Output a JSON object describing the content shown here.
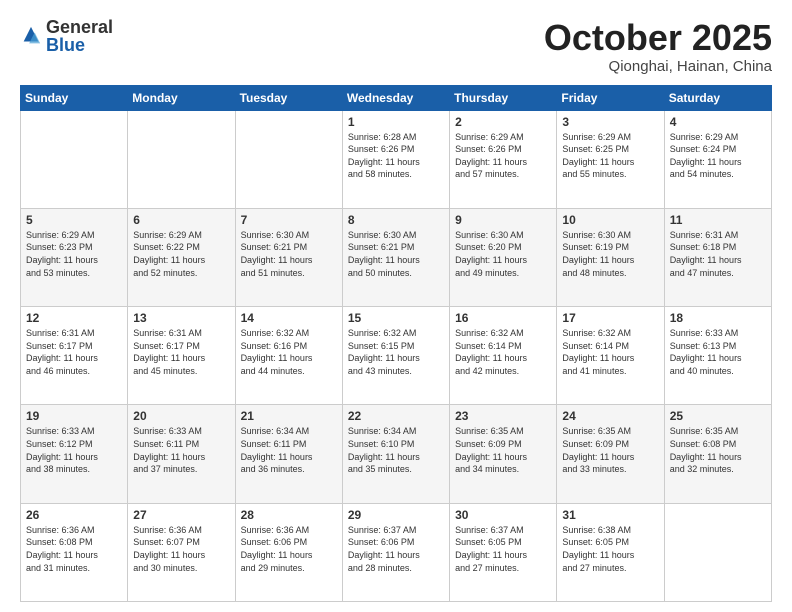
{
  "logo": {
    "general": "General",
    "blue": "Blue"
  },
  "title": "October 2025",
  "location": "Qionghai, Hainan, China",
  "weekdays": [
    "Sunday",
    "Monday",
    "Tuesday",
    "Wednesday",
    "Thursday",
    "Friday",
    "Saturday"
  ],
  "weeks": [
    [
      {
        "day": "",
        "info": ""
      },
      {
        "day": "",
        "info": ""
      },
      {
        "day": "",
        "info": ""
      },
      {
        "day": "1",
        "info": "Sunrise: 6:28 AM\nSunset: 6:26 PM\nDaylight: 11 hours\nand 58 minutes."
      },
      {
        "day": "2",
        "info": "Sunrise: 6:29 AM\nSunset: 6:26 PM\nDaylight: 11 hours\nand 57 minutes."
      },
      {
        "day": "3",
        "info": "Sunrise: 6:29 AM\nSunset: 6:25 PM\nDaylight: 11 hours\nand 55 minutes."
      },
      {
        "day": "4",
        "info": "Sunrise: 6:29 AM\nSunset: 6:24 PM\nDaylight: 11 hours\nand 54 minutes."
      }
    ],
    [
      {
        "day": "5",
        "info": "Sunrise: 6:29 AM\nSunset: 6:23 PM\nDaylight: 11 hours\nand 53 minutes."
      },
      {
        "day": "6",
        "info": "Sunrise: 6:29 AM\nSunset: 6:22 PM\nDaylight: 11 hours\nand 52 minutes."
      },
      {
        "day": "7",
        "info": "Sunrise: 6:30 AM\nSunset: 6:21 PM\nDaylight: 11 hours\nand 51 minutes."
      },
      {
        "day": "8",
        "info": "Sunrise: 6:30 AM\nSunset: 6:21 PM\nDaylight: 11 hours\nand 50 minutes."
      },
      {
        "day": "9",
        "info": "Sunrise: 6:30 AM\nSunset: 6:20 PM\nDaylight: 11 hours\nand 49 minutes."
      },
      {
        "day": "10",
        "info": "Sunrise: 6:30 AM\nSunset: 6:19 PM\nDaylight: 11 hours\nand 48 minutes."
      },
      {
        "day": "11",
        "info": "Sunrise: 6:31 AM\nSunset: 6:18 PM\nDaylight: 11 hours\nand 47 minutes."
      }
    ],
    [
      {
        "day": "12",
        "info": "Sunrise: 6:31 AM\nSunset: 6:17 PM\nDaylight: 11 hours\nand 46 minutes."
      },
      {
        "day": "13",
        "info": "Sunrise: 6:31 AM\nSunset: 6:17 PM\nDaylight: 11 hours\nand 45 minutes."
      },
      {
        "day": "14",
        "info": "Sunrise: 6:32 AM\nSunset: 6:16 PM\nDaylight: 11 hours\nand 44 minutes."
      },
      {
        "day": "15",
        "info": "Sunrise: 6:32 AM\nSunset: 6:15 PM\nDaylight: 11 hours\nand 43 minutes."
      },
      {
        "day": "16",
        "info": "Sunrise: 6:32 AM\nSunset: 6:14 PM\nDaylight: 11 hours\nand 42 minutes."
      },
      {
        "day": "17",
        "info": "Sunrise: 6:32 AM\nSunset: 6:14 PM\nDaylight: 11 hours\nand 41 minutes."
      },
      {
        "day": "18",
        "info": "Sunrise: 6:33 AM\nSunset: 6:13 PM\nDaylight: 11 hours\nand 40 minutes."
      }
    ],
    [
      {
        "day": "19",
        "info": "Sunrise: 6:33 AM\nSunset: 6:12 PM\nDaylight: 11 hours\nand 38 minutes."
      },
      {
        "day": "20",
        "info": "Sunrise: 6:33 AM\nSunset: 6:11 PM\nDaylight: 11 hours\nand 37 minutes."
      },
      {
        "day": "21",
        "info": "Sunrise: 6:34 AM\nSunset: 6:11 PM\nDaylight: 11 hours\nand 36 minutes."
      },
      {
        "day": "22",
        "info": "Sunrise: 6:34 AM\nSunset: 6:10 PM\nDaylight: 11 hours\nand 35 minutes."
      },
      {
        "day": "23",
        "info": "Sunrise: 6:35 AM\nSunset: 6:09 PM\nDaylight: 11 hours\nand 34 minutes."
      },
      {
        "day": "24",
        "info": "Sunrise: 6:35 AM\nSunset: 6:09 PM\nDaylight: 11 hours\nand 33 minutes."
      },
      {
        "day": "25",
        "info": "Sunrise: 6:35 AM\nSunset: 6:08 PM\nDaylight: 11 hours\nand 32 minutes."
      }
    ],
    [
      {
        "day": "26",
        "info": "Sunrise: 6:36 AM\nSunset: 6:08 PM\nDaylight: 11 hours\nand 31 minutes."
      },
      {
        "day": "27",
        "info": "Sunrise: 6:36 AM\nSunset: 6:07 PM\nDaylight: 11 hours\nand 30 minutes."
      },
      {
        "day": "28",
        "info": "Sunrise: 6:36 AM\nSunset: 6:06 PM\nDaylight: 11 hours\nand 29 minutes."
      },
      {
        "day": "29",
        "info": "Sunrise: 6:37 AM\nSunset: 6:06 PM\nDaylight: 11 hours\nand 28 minutes."
      },
      {
        "day": "30",
        "info": "Sunrise: 6:37 AM\nSunset: 6:05 PM\nDaylight: 11 hours\nand 27 minutes."
      },
      {
        "day": "31",
        "info": "Sunrise: 6:38 AM\nSunset: 6:05 PM\nDaylight: 11 hours\nand 27 minutes."
      },
      {
        "day": "",
        "info": ""
      }
    ]
  ]
}
